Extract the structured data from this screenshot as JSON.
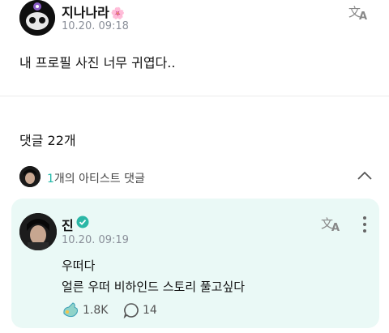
{
  "post": {
    "author": "지나나라",
    "author_suffix": "🌸",
    "time": "10.20. 09:18",
    "body": "내 프로필 사진 너무 귀엽다.."
  },
  "comments": {
    "count_label": "댓글 22개",
    "artist_count": "1",
    "artist_label": "개의 아티스트 댓글"
  },
  "artist_comment": {
    "name": "진",
    "time": "10.20. 09:19",
    "line1": "우떠다",
    "line2": "얼른 우떠 비하인드 스토리 풀고싶다",
    "likes": "1.8K",
    "replies": "14"
  },
  "colors": {
    "accent": "#1fb8a8",
    "card_bg": "#eaf9f6",
    "verified": "#2bb7a6"
  }
}
